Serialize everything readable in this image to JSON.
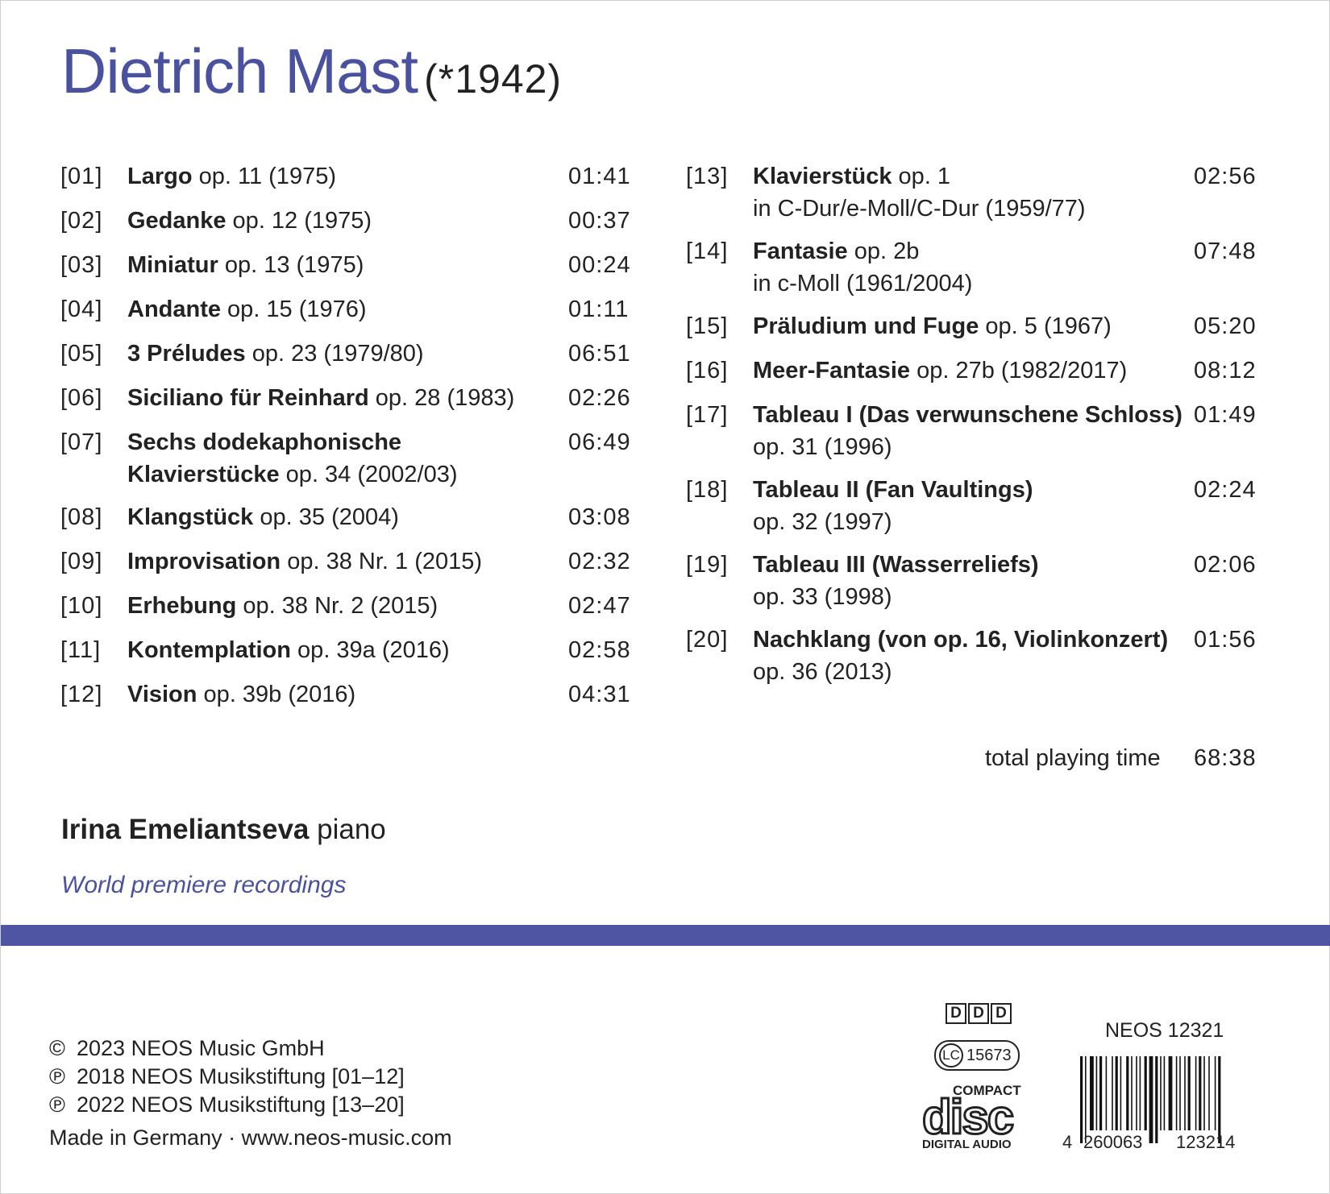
{
  "composer": {
    "name": "Dietrich Mast",
    "dates": "(*1942)"
  },
  "tracks_left": [
    {
      "num": "[01]",
      "title": "Largo",
      "rest": " op. 11 (1975)",
      "time": "01:41"
    },
    {
      "num": "[02]",
      "title": "Gedanke",
      "rest": " op. 12 (1975)",
      "time": "00:37"
    },
    {
      "num": "[03]",
      "title": "Miniatur",
      "rest": " op. 13 (1975)",
      "time": "00:24"
    },
    {
      "num": "[04]",
      "title": "Andante",
      "rest": " op. 15 (1976)",
      "time": "01:11"
    },
    {
      "num": "[05]",
      "title": "3 Préludes",
      "rest": " op. 23 (1979/80)",
      "time": "06:51"
    },
    {
      "num": "[06]",
      "title": "Siciliano für Reinhard",
      "rest": " op. 28 (1983)",
      "time": "02:26"
    },
    {
      "num": "[07]",
      "title": "Sechs dodekaphonische",
      "title2": "Klavierstücke",
      "rest2": " op. 34 (2002/03)",
      "time": "06:49"
    },
    {
      "num": "[08]",
      "title": "Klangstück",
      "rest": " op. 35 (2004)",
      "time": "03:08"
    },
    {
      "num": "[09]",
      "title": "Improvisation",
      "rest": " op. 38 Nr. 1 (2015)",
      "time": "02:32"
    },
    {
      "num": "[10]",
      "title": "Erhebung",
      "rest": " op. 38 Nr. 2 (2015)",
      "time": "02:47"
    },
    {
      "num": "[11]",
      "title": "Kontemplation",
      "rest": " op. 39a (2016)",
      "time": "02:58"
    },
    {
      "num": "[12]",
      "title": "Vision",
      "rest": " op. 39b (2016)",
      "time": "04:31"
    }
  ],
  "tracks_right": [
    {
      "num": "[13]",
      "title": "Klavierstück",
      "rest": " op. 1",
      "line2": "in C-Dur/e-Moll/C-Dur (1959/77)",
      "time": "02:56"
    },
    {
      "num": "[14]",
      "title": "Fantasie",
      "rest": " op. 2b",
      "line2": "in c-Moll (1961/2004)",
      "time": "07:48"
    },
    {
      "num": "[15]",
      "title": "Präludium und Fuge",
      "rest": " op. 5 (1967)",
      "time": "05:20"
    },
    {
      "num": "[16]",
      "title": "Meer-Fantasie",
      "rest": " op. 27b (1982/2017)",
      "time": "08:12"
    },
    {
      "num": "[17]",
      "title": "Tableau I (Das verwunschene Schloss)",
      "rest": "",
      "line2": "op. 31 (1996)",
      "time": "01:49"
    },
    {
      "num": "[18]",
      "title": "Tableau II (Fan Vaultings)",
      "rest": "",
      "line2": "op. 32 (1997)",
      "time": "02:24"
    },
    {
      "num": "[19]",
      "title": "Tableau III (Wasserreliefs)",
      "rest": "",
      "line2": "op. 33 (1998)",
      "time": "02:06"
    },
    {
      "num": "[20]",
      "title": "Nachklang (von op. 16, Violinkonzert)",
      "rest": "",
      "line2": "op. 36 (2013)",
      "time": "01:56"
    }
  ],
  "total": {
    "label": "total playing time",
    "value": "68:38"
  },
  "performer": {
    "name": "Irina Emeliantseva",
    "instrument": " piano"
  },
  "premiere": "World premiere recordings",
  "credits": [
    {
      "sym": "©",
      "text": "2023  NEOS Music GmbH"
    },
    {
      "sym": "℗",
      "text": "2018  NEOS Musikstiftung [01–12]"
    },
    {
      "sym": "℗",
      "text": "2022  NEOS Musikstiftung [13–20]"
    }
  ],
  "made_in": "Made in Germany · www.neos-music.com",
  "ddd": [
    "D",
    "D",
    "D"
  ],
  "lc": {
    "prefix": "LC",
    "code": "15673"
  },
  "cd_logo": {
    "top": "COMPACT",
    "mid": "disc",
    "bottom": "DIGITAL AUDIO"
  },
  "catalog": "NEOS 12321",
  "barcode": {
    "digits": [
      "4",
      "260063",
      "123214"
    ]
  },
  "accent_color": "#5055a3"
}
